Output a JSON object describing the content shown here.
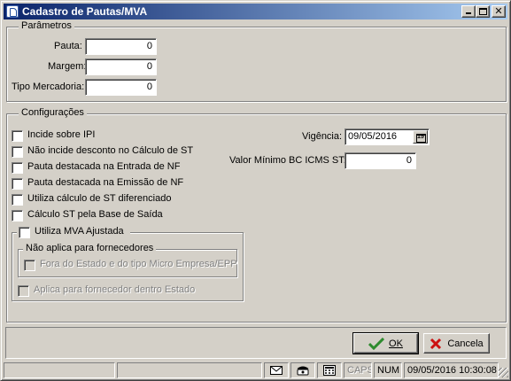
{
  "window": {
    "title": "Cadastro de Pautas/MVA"
  },
  "parametros": {
    "legend": "Parâmetros",
    "pauta": {
      "label": "Pauta:",
      "value": "0"
    },
    "margem": {
      "label": "Margem:",
      "value": "0"
    },
    "tipo_mercadoria": {
      "label": "Tipo Mercadoria:",
      "value": "0"
    }
  },
  "configuracoes": {
    "legend": "Configurações",
    "checkboxes": [
      "Incide sobre IPI",
      "Não incide desconto no Cálculo de ST",
      "Pauta destacada na Entrada de NF",
      "Pauta destacada na Emissão de NF",
      "Utiliza cálculo de ST diferenciado",
      "Cálculo ST pela Base de Saída"
    ],
    "mva_ajustada": {
      "label": "Utiliza MVA Ajustada",
      "nao_aplica_legend": "Não aplica para fornecedores",
      "fora_estado_label": "Fora do Estado e do tipo Micro Empresa/EPP",
      "aplica_dentro_label": "Aplica para fornecedor dentro Estado"
    },
    "vigencia": {
      "label": "Vigência:",
      "value": "09/05/2016"
    },
    "valor_minimo": {
      "label": "Valor Mínimo BC ICMS ST:",
      "value": "0"
    }
  },
  "buttons": {
    "ok_label": "OK",
    "cancel_label": "Cancela",
    "ok_icon": "checkmark-icon",
    "cancel_icon": "x-icon"
  },
  "statusbar": {
    "caps": "CAPS",
    "num": "NUM",
    "datetime": "09/05/2016 10:30:08",
    "icons": [
      "mail-icon",
      "phone-icon",
      "calculator-icon"
    ]
  },
  "colors": {
    "titlebar_start": "#0a246a",
    "titlebar_end": "#a6caf0",
    "face": "#d4d0c8",
    "ok_check": "#2e8b2e",
    "cancel_x": "#cc1111"
  }
}
